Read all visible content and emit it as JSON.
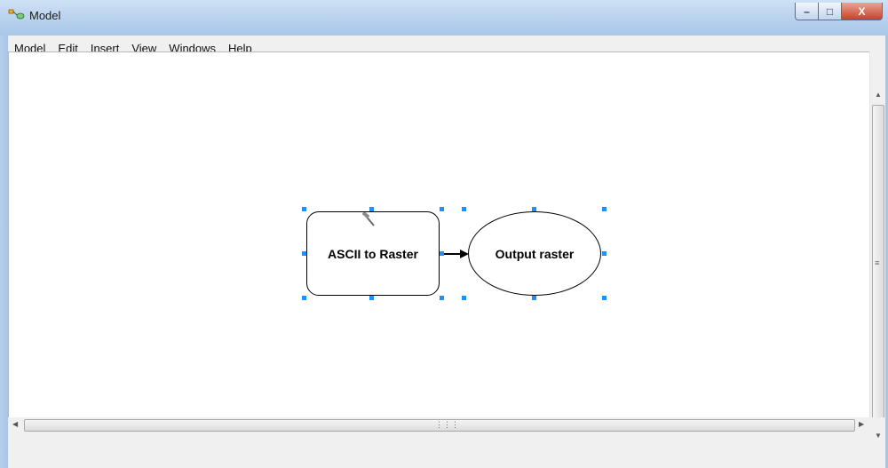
{
  "window": {
    "title": "Model",
    "controls": {
      "minimize": "–",
      "maximize": "□",
      "close": "X"
    }
  },
  "menu": [
    "Model",
    "Edit",
    "Insert",
    "View",
    "Windows",
    "Help"
  ],
  "toolbar": {
    "groups": [
      [
        {
          "icon": "save-icon",
          "glyph": "💾"
        },
        {
          "icon": "print-icon",
          "glyph": "🖨"
        }
      ],
      [
        {
          "icon": "cut-icon",
          "glyph": "✂"
        },
        {
          "icon": "copy-icon",
          "glyph": "⎘"
        },
        {
          "icon": "paste-icon",
          "glyph": "📋"
        },
        {
          "icon": "delete-icon",
          "glyph": "✖"
        }
      ],
      [
        {
          "icon": "undo-icon",
          "glyph": "↶"
        },
        {
          "icon": "redo-icon",
          "glyph": "↷"
        }
      ],
      [
        {
          "icon": "add-data-icon",
          "glyph": "✚"
        }
      ],
      [
        {
          "icon": "auto-layout-icon",
          "glyph": "▦"
        },
        {
          "icon": "full-extent-icon",
          "glyph": "⛶"
        },
        {
          "icon": "zoom-in-fixed-icon",
          "glyph": "⁘"
        },
        {
          "icon": "zoom-out-fixed-icon",
          "glyph": "⬚"
        }
      ],
      [
        {
          "icon": "zoom-icon",
          "glyph": "🔍"
        },
        {
          "icon": "pan-icon",
          "glyph": "✋"
        }
      ],
      [
        {
          "icon": "select-icon",
          "glyph": "↖"
        },
        {
          "icon": "connect-icon",
          "glyph": "↗"
        }
      ],
      [
        {
          "icon": "validate-icon",
          "glyph": "✔"
        },
        {
          "icon": "run-icon",
          "glyph": "▶"
        }
      ]
    ]
  },
  "model": {
    "tool_node": {
      "label": "ASCII to Raster"
    },
    "output_node": {
      "label": "Output raster"
    }
  },
  "colors": {
    "selection_handle": "#1e90ff",
    "run_icon": "#1e6fd9",
    "close_button": "#c8412b"
  }
}
